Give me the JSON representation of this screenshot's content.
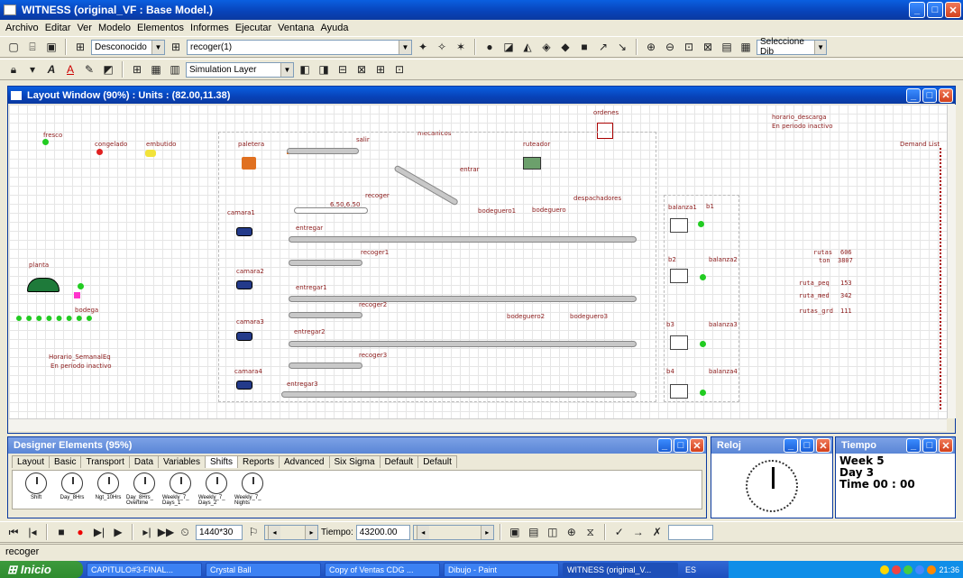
{
  "app": {
    "title": "WITNESS (original_VF : Base Model.)",
    "menu": [
      "Archivo",
      "Editar",
      "Ver",
      "Modelo",
      "Elementos",
      "Informes",
      "Ejecutar",
      "Ventana",
      "Ayuda"
    ]
  },
  "toolbar1": {
    "combo1": "Desconocido",
    "combo2": "recoger(1)",
    "combo3": "Seleccione Dib"
  },
  "toolbar2": {
    "layer_combo": "Simulation Layer"
  },
  "layout_window": {
    "title": "Layout Window (90%) : Units : (82.00,11.38)"
  },
  "canvas": {
    "labels": {
      "fresco": "fresco",
      "congelado": "congelado",
      "embutido": "embutido",
      "paletera": "paletera",
      "salir": "salir",
      "mecanicos": "mecanicos",
      "ordenes": "ordenes",
      "ruteador": "ruteador",
      "entrar": "entrar",
      "horario_descarga": "horario_descarga",
      "horario_status": "En periodo inactivo",
      "demand_list": "Demand List",
      "recoger": "recoger",
      "recoger_value": "6.50,6.50",
      "camara1": "camara1",
      "entregar": "entregar",
      "bodeguero1": "bodeguero1",
      "bodeguero": "bodeguero",
      "despachadores": "despachadores",
      "balanza1": "balanza1",
      "b1": "b1",
      "planta": "planta",
      "recoger1": "recoger1",
      "camara2": "camara2",
      "entregar1": "entregar1",
      "b2": "b2",
      "balanza2": "balanza2",
      "bodega": "bodega",
      "recoger2": "recoger2",
      "camara3": "camara3",
      "bodeguero2": "bodeguero2",
      "bodeguero3": "bodeguero3",
      "entregar2": "entregar2",
      "b3": "b3",
      "balanza3": "balanza3",
      "horario_semanal": "Horario_SemanalEq",
      "horario_semanal_status": "En periodo inactivo",
      "recoger3": "recoger3",
      "camara4": "camara4",
      "entregar3": "entregar3",
      "b4": "b4",
      "balanza4": "balanza4"
    },
    "stats": {
      "rutas_label": "rutas",
      "rutas_value": "606",
      "ton_label": "ton",
      "ton_value": "3807",
      "ruta_peq_label": "ruta_peq",
      "ruta_peq_value": "153",
      "ruta_med_label": "ruta_med",
      "ruta_med_value": "342",
      "rutas_grd_label": "rutas_grd",
      "rutas_grd_value": "111"
    }
  },
  "designer": {
    "title": "Designer Elements (95%)",
    "tabs": [
      "Layout",
      "Basic",
      "Transport",
      "Data",
      "Variables",
      "Shifts",
      "Reports",
      "Advanced",
      "Six Sigma",
      "Default",
      "Default"
    ],
    "active_tab": "Shifts",
    "elements": [
      "Shift",
      "Day_8Hrs",
      "Ngt_10Hrs",
      "Day_8Hrs_ Overtime",
      "Weekly_7_ Days_1",
      "Weekly_7_ Days_2",
      "Weekly_7_ Nights"
    ]
  },
  "reloj": {
    "title": "Reloj"
  },
  "tiempo": {
    "title": "Tiempo",
    "week": "Week  5",
    "day": "Day  3",
    "time": "Time  00 : 00"
  },
  "run_toolbar": {
    "step_value": "1440*30",
    "tiempo_label": "Tiempo:",
    "tiempo_value": "43200.00"
  },
  "status_bar": {
    "text": "recoger"
  },
  "taskbar": {
    "start": "Inicio",
    "tasks": [
      "CAPITULO#3-FINAL...",
      "Crystal Ball",
      "Copy of Ventas CDG ...",
      "Dibujo - Paint",
      "WITNESS (original_V..."
    ],
    "lang": "ES",
    "clock": "21:36"
  },
  "colors": {
    "titlebar": "#0a5fe0",
    "label_red": "#8b1a1a",
    "green": "#22cc22"
  }
}
